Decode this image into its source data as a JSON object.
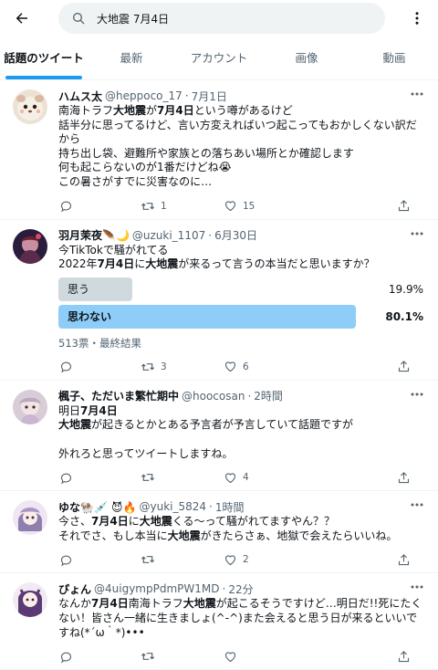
{
  "search": {
    "query": "大地震 7月4日"
  },
  "tabs": [
    "話題のツイート",
    "最新",
    "アカウント",
    "画像",
    "動画"
  ],
  "colors": {
    "accent": "#1d9bf0",
    "poll_win": "#8ecdf8",
    "poll_lose": "#cfd9de"
  },
  "tweets": [
    {
      "name": "ハムス太",
      "handle": "@heppoco_17",
      "time": "7月1日",
      "body_html": "南海トラフ<b>大地震</b>が<b>7月4日</b>という噂があるけど\n話半分に思ってるけど、言い方変えればいつ起こってもおかしくない訳だから\n持ち出し袋、避難所や家族との落ちあい場所とか確認します\n何も起こらないのが1番だけどね😭\nこの暑さがすでに災害なのに…",
      "replies": "",
      "retweets": "1",
      "likes": "15"
    },
    {
      "name": "羽月茉夜🪶🌙",
      "handle": "@uzuki_1107",
      "time": "6月30日",
      "body_html": "今TikTokで騒がれてる\n2022年<b>7月4日</b>に<b>大地震</b>が来るって言うの本当だと思いますか？",
      "poll": [
        {
          "label": "思う",
          "percent": "19.9%",
          "value": 19.9
        },
        {
          "label": "思わない",
          "percent": "80.1%",
          "value": 80.1
        }
      ],
      "poll_meta": "513票・最終結果",
      "replies": "",
      "retweets": "3",
      "likes": "6"
    },
    {
      "name": "楓子、ただいま繁忙期中",
      "handle": "@hoocosan",
      "time": "2時間",
      "body_html": "明日<b>7月4日</b>\n<b>大地震</b>が起きるとかとある予言者が予言していて話題ですが\n\n外れろと思ってツイートしますね。",
      "replies": "",
      "retweets": "",
      "likes": "4"
    },
    {
      "name": "ゆな🐏💉 😈🔥",
      "handle": "@yuki_5824",
      "time": "1時間",
      "body_html": "今さ、<b>7月4日</b>に<b>大地震</b>くる～って騒がれてますやん？？\nそれでさ、もし本当に<b>大地震</b>がきたらさぁ、地獄で会えたらいいね。",
      "replies": "",
      "retweets": "",
      "likes": "2"
    },
    {
      "name": "ぴょん",
      "handle": "@4uigympPdmPW1MD",
      "time": "22分",
      "body_html": "なんか<b>7月4日</b>南海トラフ<b>大地震</b>が起こるそうですけど…明日だ!!死にたくない！皆さん一緒に生きましょ(^-^)また会えると思う日が来るといいですね(*´ω｀*)•••",
      "replies": "",
      "retweets": "",
      "likes": ""
    }
  ]
}
